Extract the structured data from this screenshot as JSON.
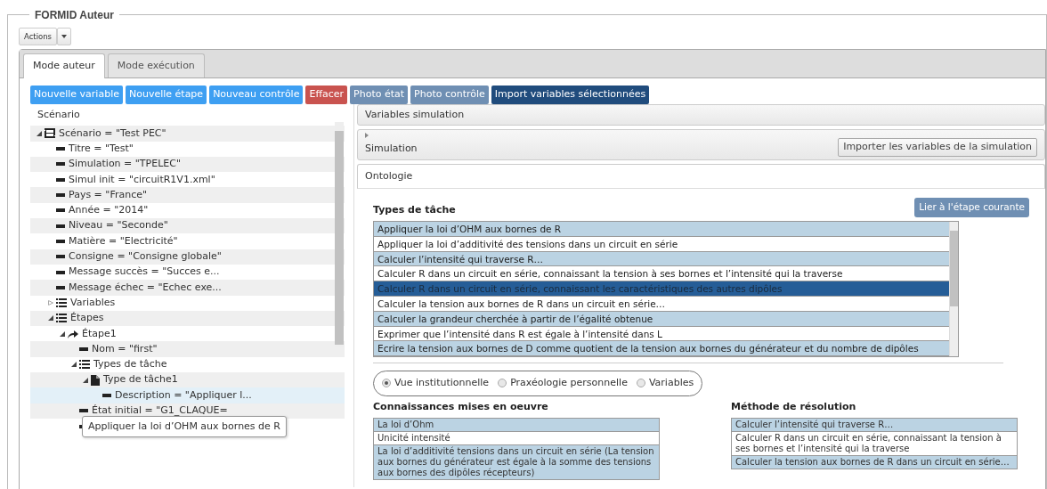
{
  "fieldset": {
    "legend": "FORMID Auteur"
  },
  "actions": {
    "label": "Actions"
  },
  "tabs": [
    {
      "label": "Mode auteur",
      "selected": true
    },
    {
      "label": "Mode exécution",
      "selected": false
    }
  ],
  "toolbar": [
    {
      "label": "Nouvelle variable",
      "kind": "create"
    },
    {
      "label": "Nouvelle étape",
      "kind": "create"
    },
    {
      "label": "Nouveau contrôle",
      "kind": "create"
    },
    {
      "label": "Effacer",
      "kind": "delete"
    },
    {
      "label": "Photo état",
      "kind": "snapshot"
    },
    {
      "label": "Photo contrôle",
      "kind": "snapshot"
    },
    {
      "label": "Import variables sélectionnées",
      "kind": "import"
    }
  ],
  "scenario": {
    "title": "Scénario",
    "tree": [
      {
        "label": "Scénario = \"Test PEC\"",
        "kind": "scenario",
        "expanded": true,
        "selected": false,
        "children": [
          {
            "label": "Titre = \"Test\"",
            "kind": "leaf",
            "selected": false
          },
          {
            "label": "Simulation = \"TPELEC\"",
            "kind": "leaf",
            "selected": false
          },
          {
            "label": "Simul init = \"circuitR1V1.xml\"",
            "kind": "leaf",
            "selected": false
          },
          {
            "label": "Pays = \"France\"",
            "kind": "leaf",
            "selected": false
          },
          {
            "label": "Année = \"2014\"",
            "kind": "leaf",
            "selected": false
          },
          {
            "label": "Niveau = \"Seconde\"",
            "kind": "leaf",
            "selected": false
          },
          {
            "label": "Matière = \"Electricité\"",
            "kind": "leaf",
            "selected": false
          },
          {
            "label": "Consigne = \"Consigne globale\"",
            "kind": "leaf",
            "selected": false
          },
          {
            "label": "Message succès = \"Succes e...",
            "kind": "leaf",
            "selected": false
          },
          {
            "label": "Message échec = \"Echec exe...",
            "kind": "leaf",
            "selected": false
          },
          {
            "label": "Variables",
            "kind": "list",
            "expanded": false,
            "selected": false
          },
          {
            "label": "Étapes",
            "kind": "list",
            "expanded": true,
            "selected": false,
            "children": [
              {
                "label": "Étape1",
                "kind": "step",
                "expanded": true,
                "selected": false,
                "children": [
                  {
                    "label": "Nom = \"first\"",
                    "kind": "leaf",
                    "selected": false
                  },
                  {
                    "label": "Types de tâche",
                    "kind": "list",
                    "expanded": true,
                    "selected": false,
                    "children": [
                      {
                        "label": "Type de tâche1",
                        "kind": "task",
                        "expanded": true,
                        "selected": false,
                        "children": [
                          {
                            "label": "Description = \"Appliquer l...",
                            "kind": "leaf",
                            "selected": true
                          }
                        ]
                      }
                    ]
                  },
                  {
                    "label": "État initial = \"G1_CLAQUE=",
                    "kind": "leaf",
                    "selected": false
                  },
                  {
                    "kind": "leaf",
                    "selected": false
                  }
                ]
              }
            ]
          }
        ]
      }
    ]
  },
  "tooltip": "Appliquer la loi d’OHM aux bornes de R",
  "variables_simulation": {
    "title": "Variables simulation"
  },
  "simulation": {
    "title": "Simulation",
    "expanded": false,
    "button": "Importer les variables de la simulation"
  },
  "ontologie": {
    "title": "Ontologie",
    "task_types": {
      "title": "Types de tâche",
      "button": "Lier à l'étape courante",
      "items": [
        {
          "label": "Appliquer la loi d’OHM aux bornes de R",
          "selected": false
        },
        {
          "label": "Appliquer la loi d’additivité des tensions dans un circuit en série",
          "selected": false
        },
        {
          "label": "Calculer l’intensité qui traverse R…",
          "selected": false
        },
        {
          "label": "Calculer R dans un circuit en série, connaissant la tension à ses bornes et l’intensité qui la traverse",
          "selected": false
        },
        {
          "label": "Calculer R dans un circuit en série, connaissant les caractéristiques des autres dipôles",
          "selected": true
        },
        {
          "label": "Calculer la tension aux bornes de R dans un circuit en série…",
          "selected": false
        },
        {
          "label": "Calculer la grandeur cherchée à partir de l’égalité obtenue",
          "selected": false
        },
        {
          "label": "Exprimer que l’intensité dans R est égale à l’intensité dans L",
          "selected": false
        },
        {
          "label": "Ecrire la tension aux bornes de D comme quotient de la tension aux bornes du générateur et du nombre de dipôles",
          "selected": false
        }
      ]
    },
    "views": [
      {
        "label": "Vue institutionnelle",
        "selected": true
      },
      {
        "label": "Praxéologie personnelle",
        "selected": false
      },
      {
        "label": "Variables",
        "selected": false
      }
    ],
    "knowledge": {
      "title": "Connaissances mises en oeuvre",
      "items": [
        "La loi d’Ohm",
        "Unicité intensité",
        "La loi d’additivité tensions dans un circuit en série (La tension aux bornes du générateur est égale à la somme des tensions aux bornes des dipôles récepteurs)"
      ]
    },
    "method": {
      "title": "Méthode de résolution",
      "items": [
        "Calculer l’intensité qui traverse R…",
        "Calculer R dans un circuit en série, connaissant la tension à ses bornes et l’intensité qui la traverse",
        "Calculer la tension aux bornes de R dans un circuit en série…"
      ]
    }
  }
}
